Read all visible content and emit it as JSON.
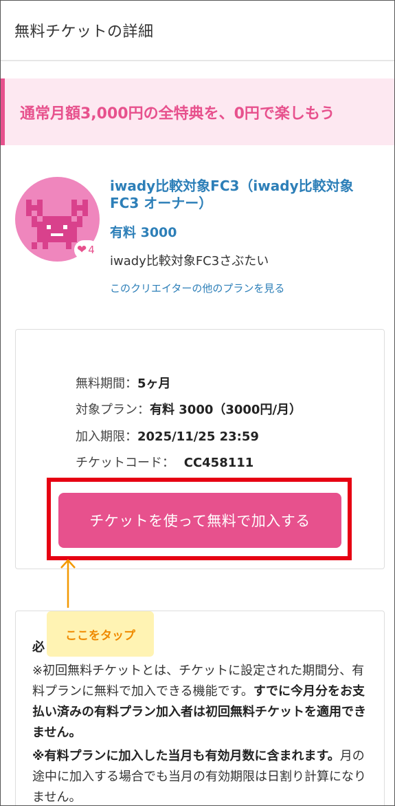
{
  "header": {
    "title": "無料チケットの詳細"
  },
  "promo": {
    "text": "通常月額3,000円の全特典を、0円で楽しもう",
    "accent": "#e7518d",
    "background": "#fde8f1"
  },
  "creator": {
    "avatar_icon": "crab-icon",
    "favorites_count": "4",
    "name": "iwady比較対象FC3（iwady比較対象FC3 オーナー）",
    "plan_name": "有料 3000",
    "plan_title": "iwady比較対象FC3さぶたい",
    "other_plans_link": "このクリエイターの他のプランを見る"
  },
  "ticket": {
    "free_period_label": "無料期間：",
    "free_period_value": "5ヶ月",
    "target_plan_label": "対象プラン：",
    "target_plan_value": "有料 3000（3000円/月）",
    "deadline_label": "加入期限：",
    "deadline_value": "2025/11/25 23:59",
    "code_label": "チケットコード：",
    "code_value": "CC458111",
    "cta_label": "チケットを使って無料で加入する"
  },
  "annotation": {
    "tooltip": "ここをタップ",
    "highlight_color": "#e60012",
    "arrow_color": "#f39800"
  },
  "notes": {
    "heading": "必",
    "p1_normal": "※初回無料チケットとは、チケットに設定された期間分、有料プランに無料で加入できる機能です。",
    "p1_bold": "すでに今月分をお支払い済みの有料プラン加入者は初回無料チケットを適用できません。",
    "p2_bold": "※有料プランに加入した当月も有効月数に含まれます。",
    "p2_normal": "月の途中に加入する場合でも当月の有効期限は日割り計算になりません。"
  }
}
